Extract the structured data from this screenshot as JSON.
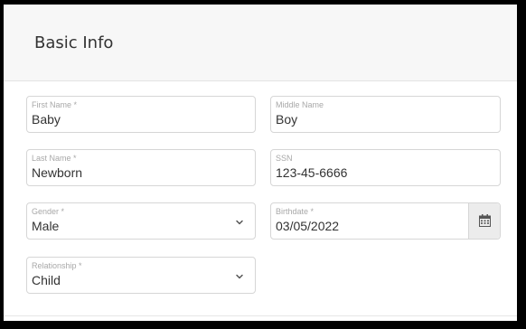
{
  "section": {
    "title": "Basic Info"
  },
  "fields": {
    "first_name": {
      "label": "First Name *",
      "value": "Baby"
    },
    "middle_name": {
      "label": "Middle Name",
      "value": "Boy"
    },
    "last_name": {
      "label": "Last Name *",
      "value": "Newborn"
    },
    "ssn": {
      "label": "SSN",
      "value": "123-45-6666"
    },
    "gender": {
      "label": "Gender *",
      "value": "Male"
    },
    "birthdate": {
      "label": "Birthdate *",
      "value": "03/05/2022"
    },
    "relationship": {
      "label": "Relationship *",
      "value": "Child"
    }
  },
  "icons": {
    "gender_dropdown": "chevron-down-icon",
    "relationship_dropdown": "chevron-down-icon",
    "birthdate_picker": "calendar-icon"
  },
  "colors": {
    "header_background": "#f7f7f7",
    "field_border": "#d6d6d6",
    "label_text": "#a8a8a8",
    "value_text": "#333333",
    "addon_background": "#ececec"
  }
}
